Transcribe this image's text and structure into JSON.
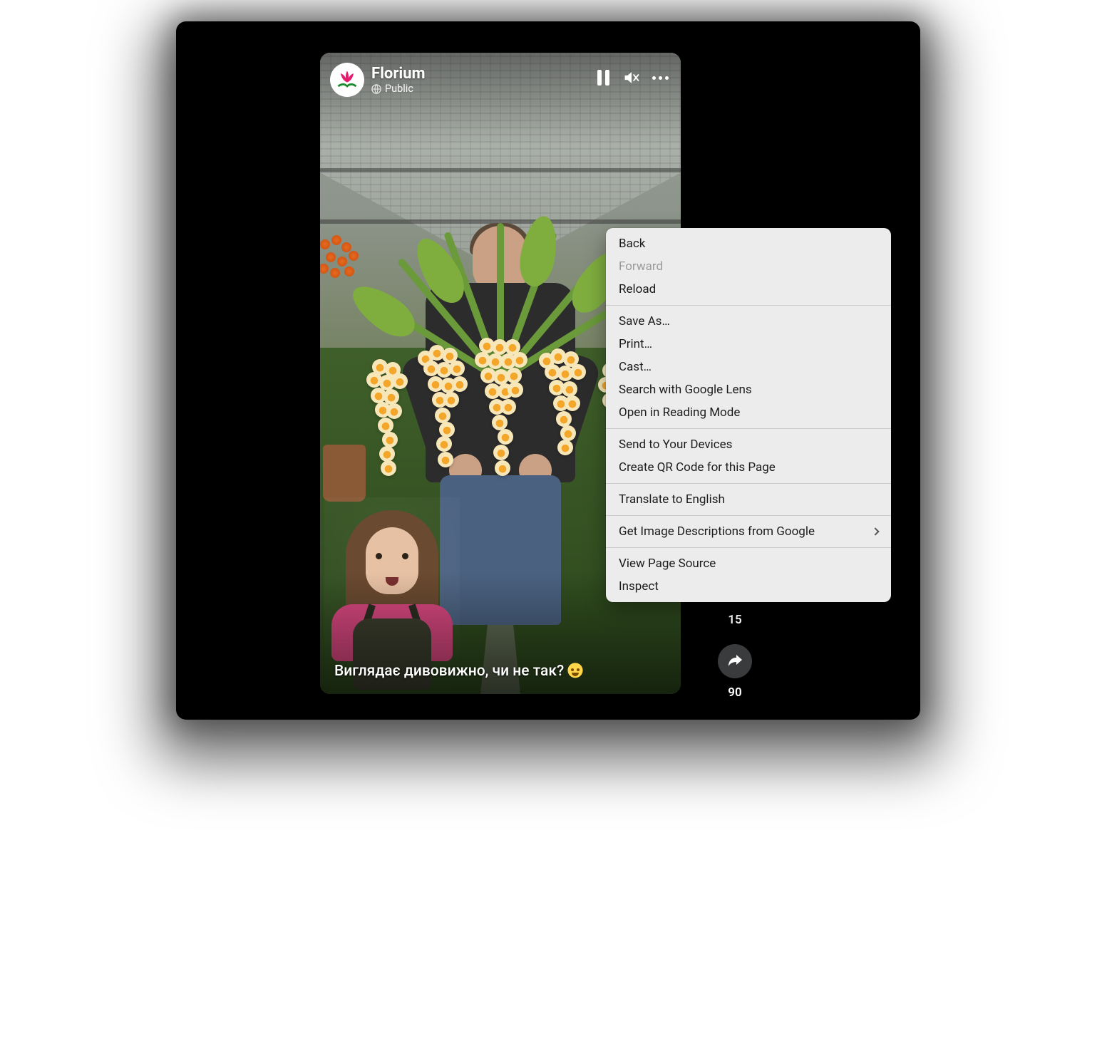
{
  "story": {
    "page_name": "Florium",
    "privacy_label": "Public",
    "caption_text": "Виглядає дивовижно, чи не так?"
  },
  "actions": {
    "comment_count": "15",
    "share_count": "90"
  },
  "context_menu": {
    "back": "Back",
    "forward": "Forward",
    "reload": "Reload",
    "save_as": "Save As…",
    "print": "Print…",
    "cast": "Cast…",
    "search_lens": "Search with Google Lens",
    "reading_mode": "Open in Reading Mode",
    "send_devices": "Send to Your Devices",
    "create_qr": "Create QR Code for this Page",
    "translate": "Translate to English",
    "image_descriptions": "Get Image Descriptions from Google",
    "view_source": "View Page Source",
    "inspect": "Inspect"
  }
}
